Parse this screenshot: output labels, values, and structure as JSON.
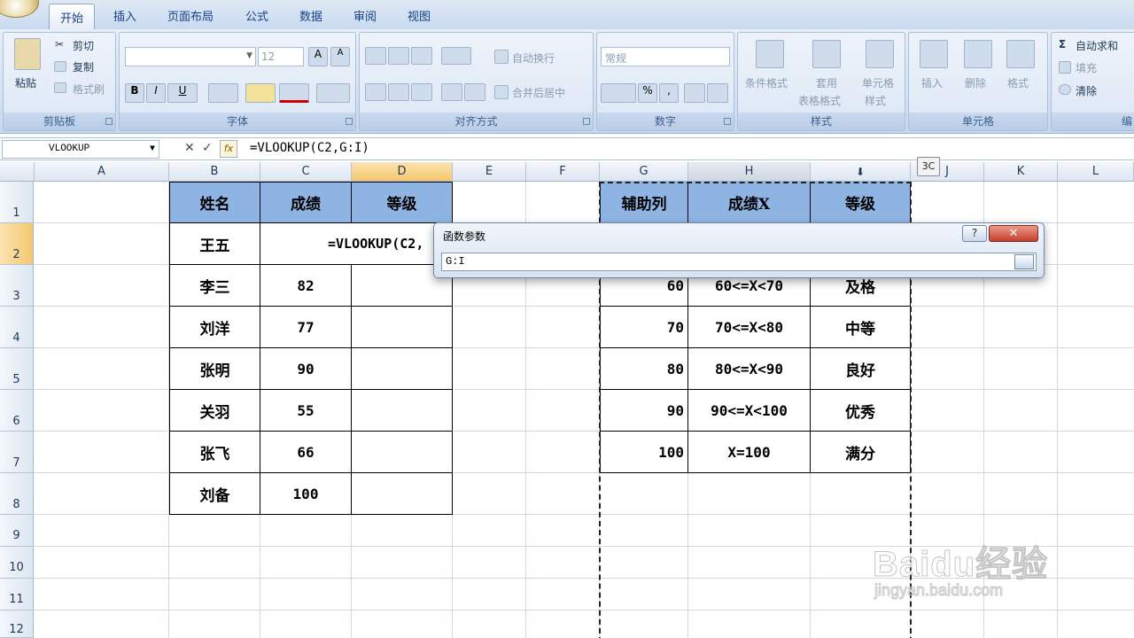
{
  "ribbon_tabs": [
    "开始",
    "插入",
    "页面布局",
    "公式",
    "数据",
    "审阅",
    "视图"
  ],
  "clipboard": {
    "paste": "粘贴",
    "cut": "剪切",
    "copy": "复制",
    "format_painter": "格式刷",
    "title": "剪贴板"
  },
  "font": {
    "size": "12",
    "bold": "B",
    "italic": "I",
    "underline": "U",
    "title": "字体"
  },
  "alignment": {
    "wrap": "自动换行",
    "merge": "合并后居中",
    "title": "对齐方式"
  },
  "number": {
    "format": "常规",
    "percent": "%",
    "comma": ",",
    "title": "数字"
  },
  "styles": {
    "cond": "条件格式",
    "table": "套用",
    "table2": "表格格式",
    "cell": "单元格",
    "cell2": "样式",
    "title": "样式"
  },
  "cells": {
    "insert": "插入",
    "delete": "删除",
    "format": "格式",
    "title": "单元格"
  },
  "editing": {
    "autosum": "自动求和",
    "fill": "填充",
    "clear": "清除",
    "title_partial": "编"
  },
  "formula_bar": {
    "name_box": "VLOOKUP",
    "formula": "=VLOOKUP(C2,G:I)",
    "cancel": "✕",
    "enter": "✓",
    "fx": "fx"
  },
  "columns": [
    "A",
    "B",
    "C",
    "D",
    "E",
    "F",
    "G",
    "H",
    "I",
    "J",
    "K",
    "L"
  ],
  "rows": [
    "1",
    "2",
    "3",
    "4",
    "5",
    "6",
    "7",
    "8",
    "9",
    "10",
    "11",
    "12"
  ],
  "left_table": {
    "headers": [
      "姓名",
      "成绩",
      "等级"
    ],
    "rows": [
      [
        "王五",
        "",
        ""
      ],
      [
        "李三",
        "82",
        ""
      ],
      [
        "刘洋",
        "77",
        ""
      ],
      [
        "张明",
        "90",
        ""
      ],
      [
        "关羽",
        "55",
        ""
      ],
      [
        "张飞",
        "66",
        ""
      ],
      [
        "刘备",
        "100",
        ""
      ]
    ],
    "editing_text": "=VLOOKUP(C2,"
  },
  "right_table": {
    "headers": [
      "辅助列",
      "成绩X",
      "等级"
    ],
    "rows": [
      [
        "60",
        "60<=X<70",
        "及格"
      ],
      [
        "70",
        "70<=X<80",
        "中等"
      ],
      [
        "80",
        "80<=X<90",
        "良好"
      ],
      [
        "90",
        "90<=X<100",
        "优秀"
      ],
      [
        "100",
        "X=100",
        "满分"
      ]
    ]
  },
  "dialog": {
    "title": "函数参数",
    "help": "?",
    "close": "✕",
    "value": "G:I"
  },
  "tooltip": "3C",
  "watermark": {
    "brand": "Baidu经验",
    "url": "jingyan.baidu.com"
  },
  "colors": {
    "header_fill": "#8eb4e3",
    "accent": "#15428b"
  }
}
